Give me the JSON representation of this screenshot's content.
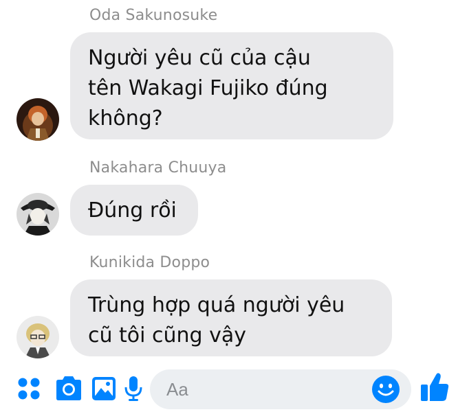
{
  "accent_color": "#0084ff",
  "bubble_color": "#e9e9eb",
  "messages": [
    {
      "sender": "Oda Sakunosuke",
      "avatar_icon": "oda-avatar",
      "text": "Người yêu cũ của cậu\ntên Wakagi Fujiko đúng\nkhông?"
    },
    {
      "sender": "Nakahara Chuuya",
      "avatar_icon": "chuuya-avatar",
      "text": "Đúng rồi"
    },
    {
      "sender": "Kunikida Doppo",
      "avatar_icon": "kunikida-avatar",
      "text": "Trùng hợp quá người yêu\ncũ tôi cũng vậy"
    }
  ],
  "composer": {
    "placeholder": "Aa",
    "icons": [
      "apps-grid-icon",
      "camera-icon",
      "image-icon",
      "microphone-icon",
      "emoji-icon",
      "thumbs-up-icon"
    ]
  }
}
